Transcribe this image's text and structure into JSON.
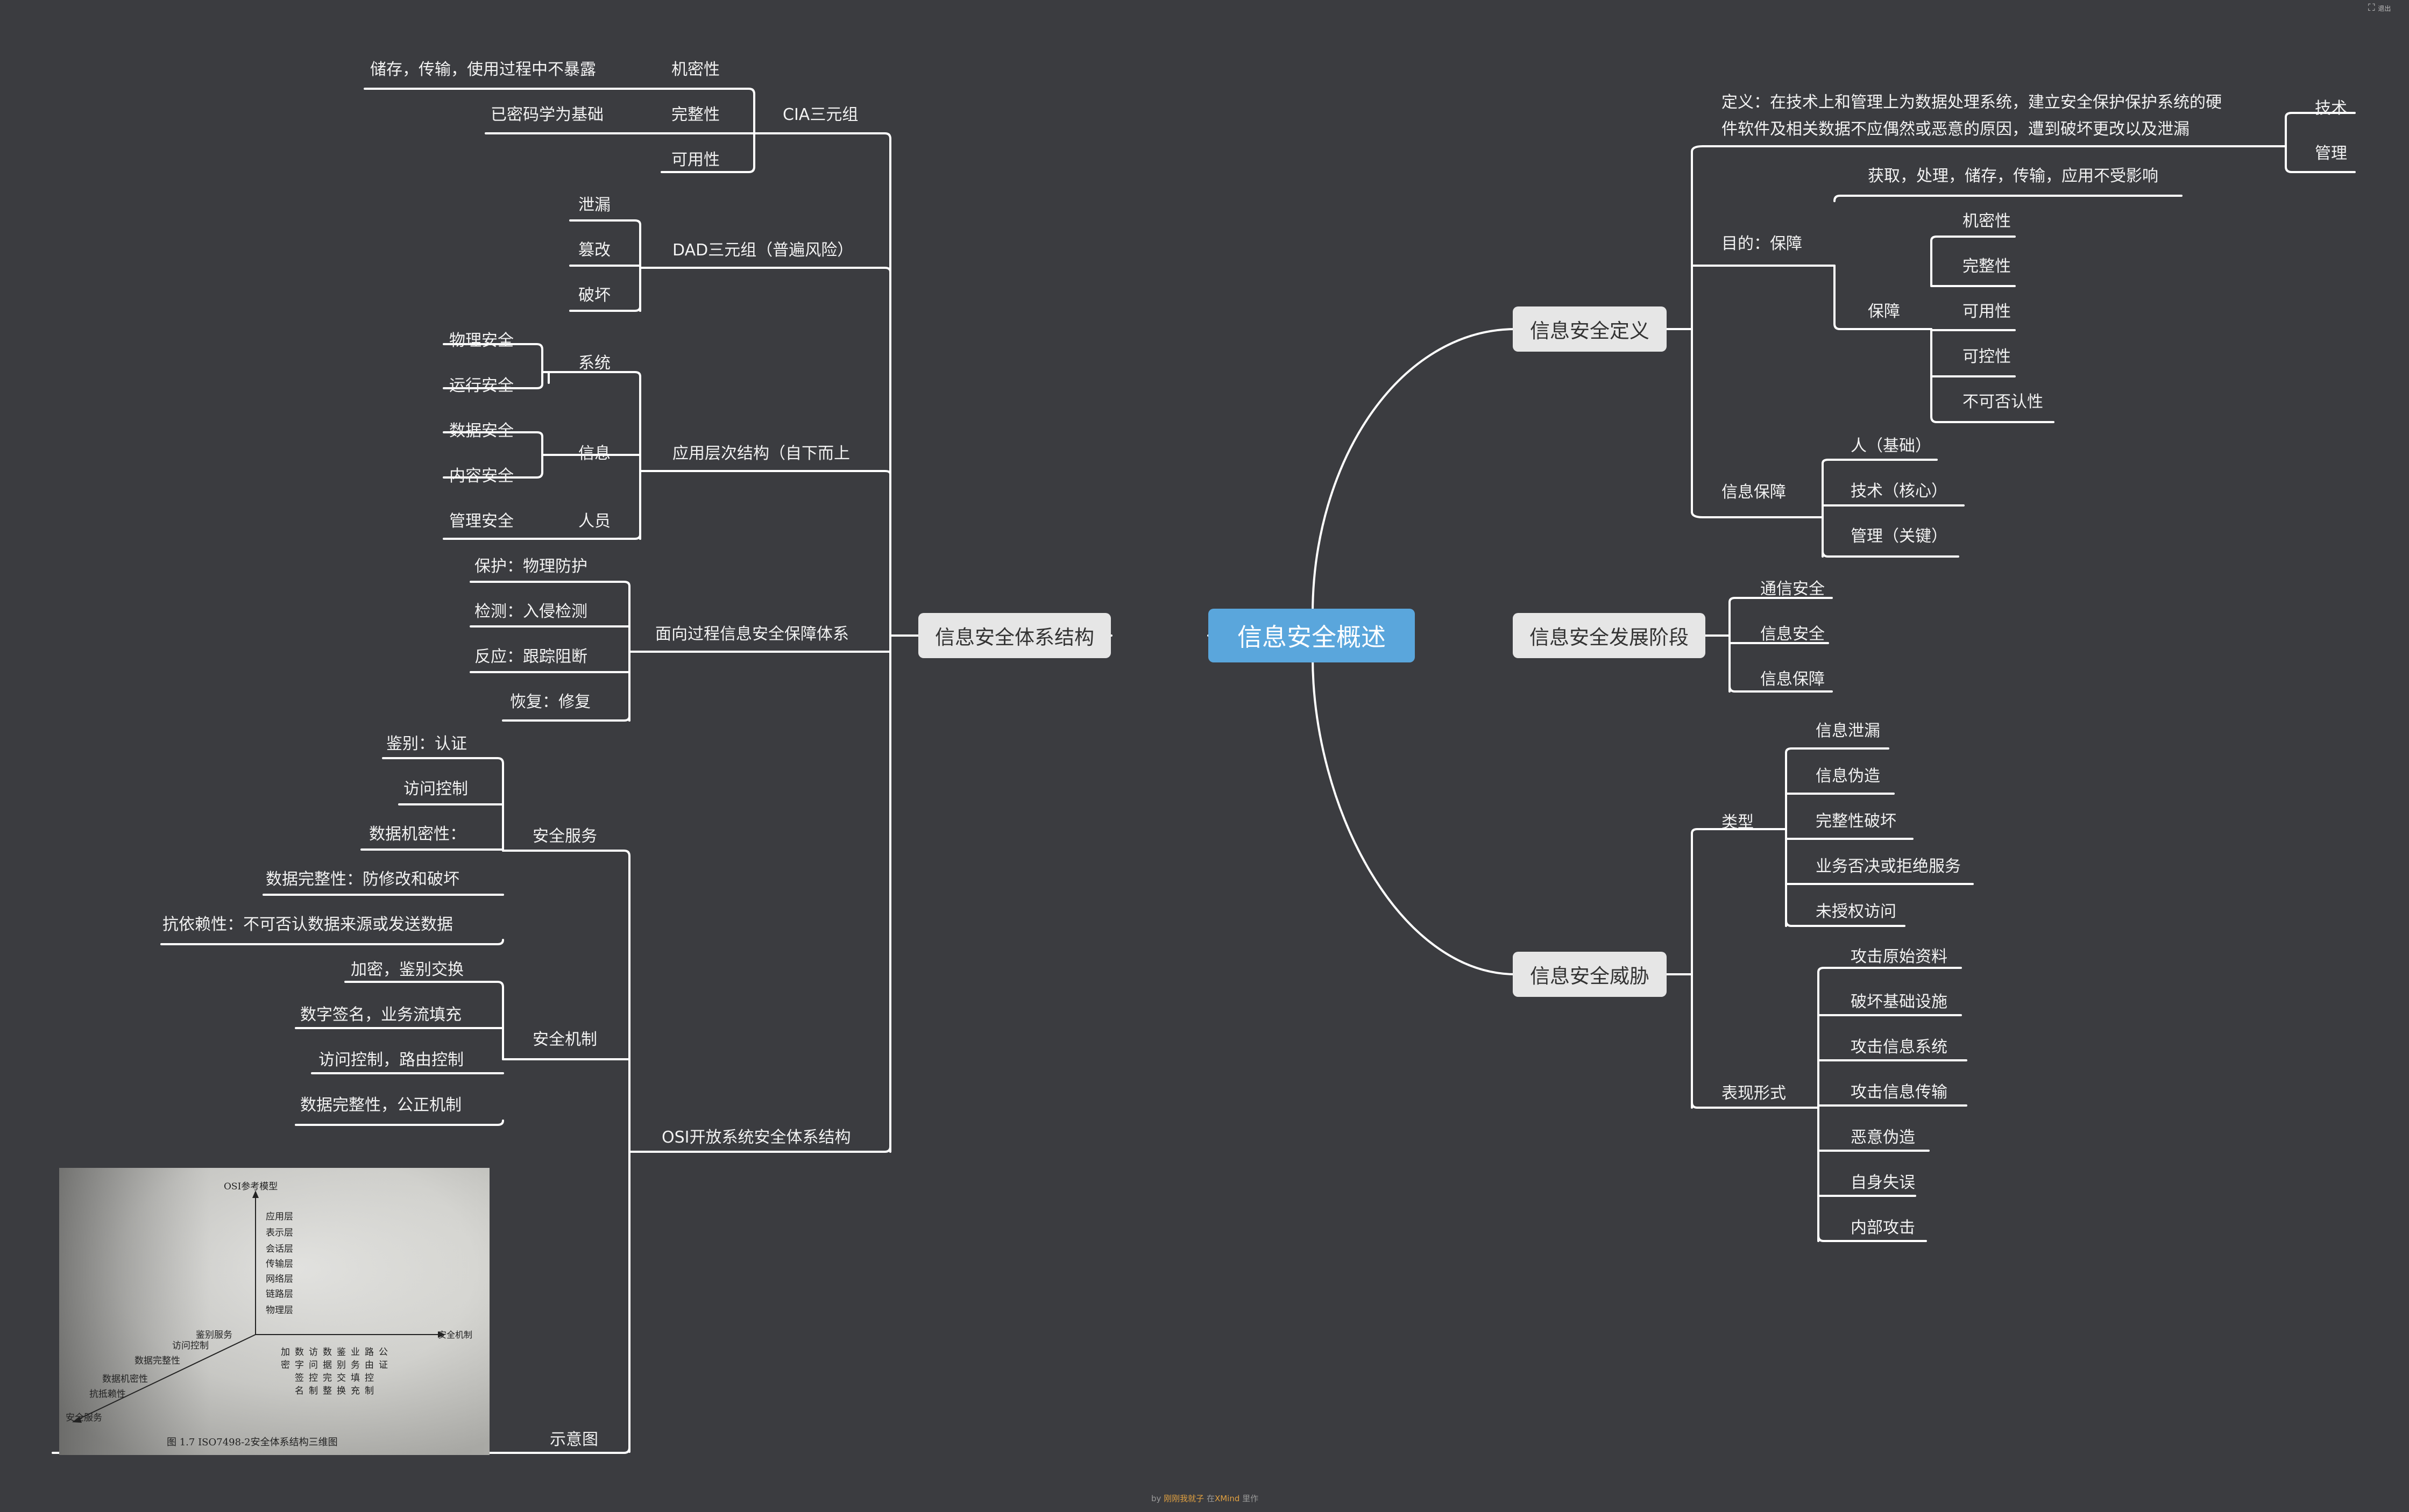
{
  "center": "信息安全概述",
  "topics": {
    "definition": "信息安全定义",
    "stages": "信息安全发展阶段",
    "threats": "信息安全威胁",
    "architecture": "信息安全体系结构"
  },
  "definition": {
    "def_label": "定义：在技术上和管理上为数据处理系统，建立安全保护保护系统的硬",
    "def_label_2": "件软件及相关数据不应偶然或恶意的原因，遭到破坏更改以及泄漏",
    "def_children": [
      "技术",
      "管理"
    ],
    "purpose": "目的：保障",
    "purpose_children": [
      "获取，处理，储存，传输，应用不受影响",
      "保障"
    ],
    "guarantee_children": [
      "机密性",
      "完整性",
      "可用性",
      "可控性",
      "不可否认性"
    ],
    "info_assurance": "信息保障",
    "info_assurance_children": [
      "人（基础）",
      "技术（核心）",
      "管理（关键）"
    ]
  },
  "stages": [
    "通信安全",
    "信息安全",
    "信息保障"
  ],
  "threats": {
    "types": "类型",
    "type_items": [
      "信息泄漏",
      "信息伪造",
      "完整性破坏",
      "业务否决或拒绝服务",
      "未授权访问"
    ],
    "forms": "表现形式",
    "form_items": [
      "攻击原始资料",
      "破坏基础设施",
      "攻击信息系统",
      "攻击信息传输",
      "恶意伪造",
      "自身失误",
      "内部攻击"
    ]
  },
  "architecture": {
    "cia": "CIA三元组",
    "cia_items": [
      {
        "prop": "机密性",
        "desc": "储存，传输，使用过程中不暴露"
      },
      {
        "prop": "完整性",
        "desc": "已密码学为基础"
      },
      {
        "prop": "可用性",
        "desc": ""
      }
    ],
    "dad": "DAD三元组（普遍风险）",
    "dad_items": [
      "泄漏",
      "篡改",
      "破坏"
    ],
    "layers": "应用层次结构（自下而上",
    "layer_groups": [
      {
        "name": "系统",
        "items": [
          "物理安全",
          "运行安全"
        ]
      },
      {
        "name": "信息",
        "items": [
          "数据安全",
          "内容安全"
        ]
      },
      {
        "name": "人员",
        "items": [
          "管理安全"
        ]
      }
    ],
    "process": "面向过程信息安全保障体系",
    "process_items": [
      "保护：物理防护",
      "检测：入侵检测",
      "反应：跟踪阻断",
      "恢复：修复"
    ],
    "osi": "OSI开放系统安全体系结构",
    "services": "安全服务",
    "service_items": [
      "鉴别：认证",
      "访问控制",
      "数据机密性：",
      "数据完整性：防修改和破坏",
      "抗依赖性：不可否认数据来源或发送数据"
    ],
    "mechanisms": "安全机制",
    "mechanism_items": [
      "加密，鉴别交换",
      "数字签名，业务流填充",
      "访问控制，路由控制",
      "数据完整性，公正机制"
    ],
    "diagram": "示意图"
  },
  "osi_figure": {
    "y_axis_label": "OSI参考模型",
    "layers": [
      "应用层",
      "表示层",
      "会话层",
      "传输层",
      "网络层",
      "链路层",
      "物理层"
    ],
    "x_axis_label": "安全机制",
    "x_items": [
      "加密",
      "数字签名",
      "访问控制",
      "数据完整",
      "鉴别交换",
      "业务填充",
      "路由控制",
      "公证"
    ],
    "z_axis_label": "安全服务",
    "z_items": [
      "鉴别服务",
      "访问控制",
      "数据完整性",
      "数据机密性",
      "抗抵赖性"
    ],
    "caption": "图 1.7  ISO7498-2安全体系结构三维图"
  },
  "ui": {
    "corner_icon": "fullscreen-icon",
    "corner_label": "退出",
    "footer_prefix": "by ",
    "footer_author": "刚刚我就子",
    "footer_mid": " 在",
    "footer_app": "XMind",
    "footer_suffix": " 里作"
  },
  "colors": {
    "background": "#3b3c40",
    "line": "#ffffff",
    "topic_bg": "#e6e6e6",
    "center_bg": "#5aa6dc"
  }
}
